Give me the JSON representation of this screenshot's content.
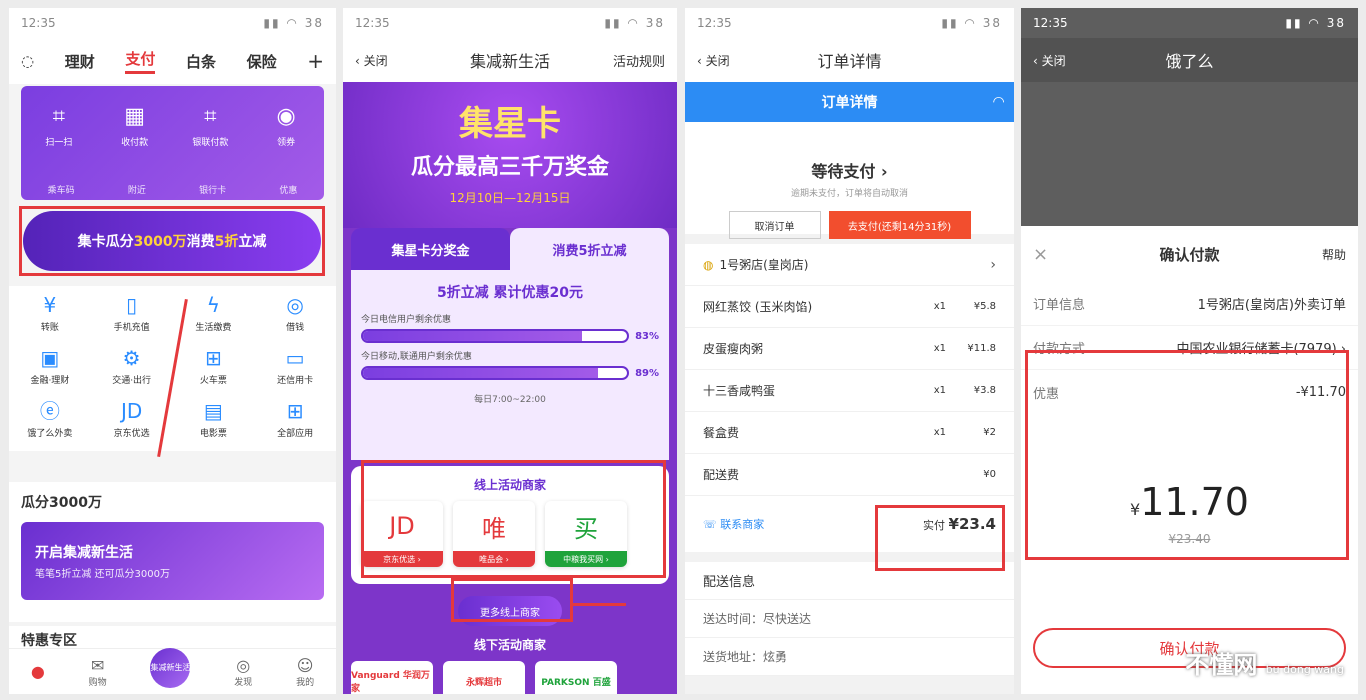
{
  "status_time": "12:35",
  "status_battery": "38",
  "p1": {
    "nav": [
      "理财",
      "支付",
      "白条",
      "保险"
    ],
    "pay_items": [
      "扫一扫",
      "收付款",
      "银联付款",
      "领券"
    ],
    "pay_row2": [
      "乘车码",
      "附近",
      "银行卡",
      "优惠"
    ],
    "banner_pre": "集卡瓜分",
    "banner_num": "3000万",
    "banner_mid": " 消费",
    "banner_disc": "5折",
    "banner_post": "立减",
    "grid": [
      {
        "label": "转账",
        "icon": "¥"
      },
      {
        "label": "手机充值",
        "icon": "▯"
      },
      {
        "label": "生活缴费",
        "icon": "ϟ"
      },
      {
        "label": "借钱",
        "icon": "◎"
      },
      {
        "label": "金融·理财",
        "icon": "▣"
      },
      {
        "label": "交通·出行",
        "icon": "⚙"
      },
      {
        "label": "火车票",
        "icon": "⊞"
      },
      {
        "label": "还信用卡",
        "icon": "▭"
      },
      {
        "label": "饿了么外卖",
        "icon": "ⓔ"
      },
      {
        "label": "京东优选",
        "icon": "JD"
      },
      {
        "label": "电影票",
        "icon": "▤"
      },
      {
        "label": "全部应用",
        "icon": "⊞"
      }
    ],
    "section1": "瓜分3000万",
    "promo_title": "开启集减新生活",
    "promo_sub": "笔笔5折立减 还可瓜分3000万",
    "section2": "特惠专区",
    "tabs": [
      "购物",
      "集减新生活",
      "发现",
      "我的"
    ]
  },
  "p2": {
    "back": "关闭",
    "title": "集减新生活",
    "rules": "活动规则",
    "hero_t1": "集星卡",
    "hero_t2": "瓜分最高三千万奖金",
    "hero_date": "12月10日—12月15日",
    "tab_a": "集星卡分奖金",
    "tab_b": "消费5折立减",
    "panel_title": "5折立减 累计优惠20元",
    "bar1_label": "今日电信用户剩余优惠",
    "bar1_pct": "83%",
    "bar1_val": 0.83,
    "bar2_label": "今日移动,联通用户剩余优惠",
    "bar2_pct": "89%",
    "bar2_val": 0.89,
    "hours": "每日7:00~22:00",
    "online_title": "线上活动商家",
    "merchants": [
      {
        "logo": "JD",
        "name": "京东优选 ›",
        "color": "#e4393c"
      },
      {
        "logo": "唯",
        "name": "唯品会 ›",
        "color": "#e4393c"
      },
      {
        "logo": "买",
        "name": "中粮我买网 ›",
        "color": "#1fa33b"
      }
    ],
    "more": "更多线上商家",
    "offline_title": "线下活动商家",
    "offline": [
      "Vanguard 华润万家",
      "永辉超市",
      "PARKSON 百盛"
    ]
  },
  "p3": {
    "back": "关闭",
    "title": "订单详情",
    "blue_title": "订单详情",
    "wait": "等待支付 ›",
    "wait_sub": "逾期未支付，订单将自动取消",
    "cancel": "取消订单",
    "pay": "去支付(还剩14分31秒)",
    "shop": "1号粥店(皇岗店)",
    "items": [
      {
        "n": "网红蒸饺 (玉米肉馅)",
        "q": "x1",
        "p": "¥5.8"
      },
      {
        "n": "皮蛋瘦肉粥",
        "q": "x1",
        "p": "¥11.8"
      },
      {
        "n": "十三香咸鸭蛋",
        "q": "x1",
        "p": "¥3.8"
      },
      {
        "n": "餐盒费",
        "q": "x1",
        "p": "¥2"
      },
      {
        "n": "配送费",
        "q": "",
        "p": "¥0"
      }
    ],
    "contact": "联系商家",
    "paid_label": "实付 ",
    "paid": "¥23.4",
    "delivery": "配送信息",
    "d_time": "送达时间：尽快送达",
    "d_addr": "送货地址：炫勇"
  },
  "p4": {
    "back": "关闭",
    "title": "饿了么",
    "confirm": "确认付款",
    "help": "帮助",
    "order_k": "订单信息",
    "order_v": "1号粥店(皇岗店)外卖订单",
    "method_k": "付款方式",
    "method_v": "中国农业银行储蓄卡(7979) ›",
    "disc_k": "优惠",
    "disc_v": "-¥11.70",
    "cur": "¥",
    "amount": "11.70",
    "old": "¥23.40",
    "btn": "确认付款"
  },
  "watermark": "不懂网",
  "watermark_sub": "bu dong wang"
}
